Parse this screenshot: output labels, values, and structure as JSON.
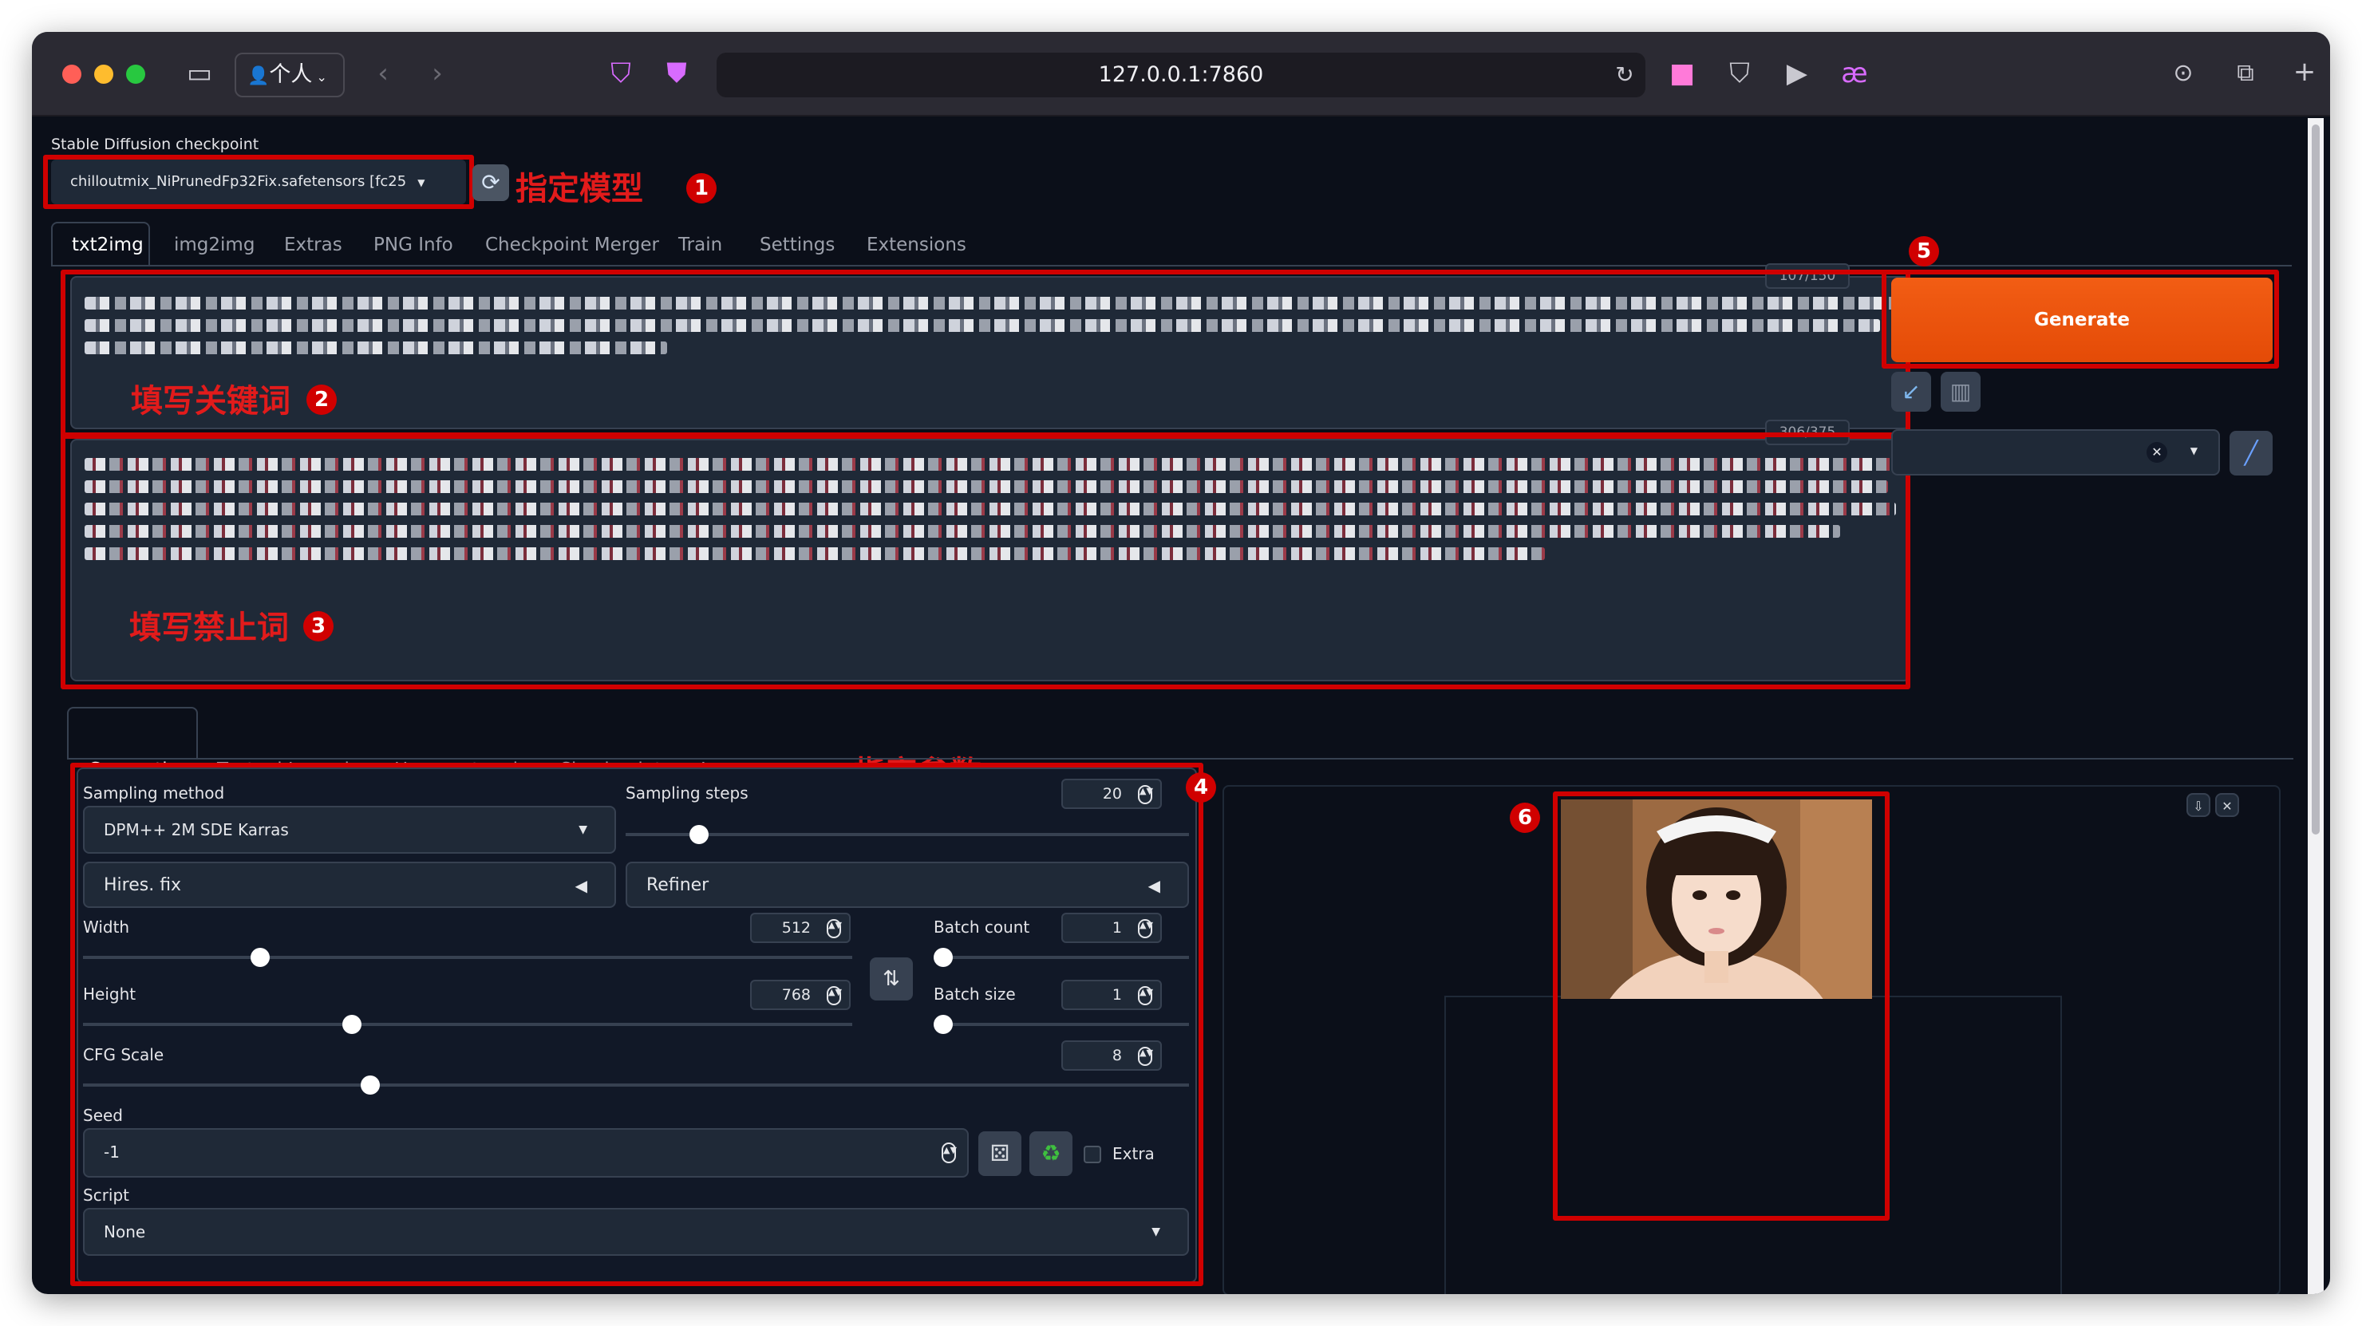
{
  "browser": {
    "profile_label": "个人",
    "url": "127.0.0.1:7860"
  },
  "checkpoint": {
    "label": "Stable Diffusion checkpoint",
    "value": "chilloutmix_NiPrunedFp32Fix.safetensors [fc25"
  },
  "main_tabs": [
    "txt2img",
    "img2img",
    "Extras",
    "PNG Info",
    "Checkpoint Merger",
    "Train",
    "Settings",
    "Extensions"
  ],
  "prompt": {
    "counter": "107/150"
  },
  "negative_prompt": {
    "counter": "306/375"
  },
  "generate_label": "Generate",
  "sub_tabs": [
    "Generation",
    "Textual Inversion",
    "Hypernetworks",
    "Checkpoints",
    "Lora"
  ],
  "params": {
    "sampling_method_label": "Sampling method",
    "sampling_method": "DPM++ 2M SDE Karras",
    "sampling_steps_label": "Sampling steps",
    "sampling_steps": "20",
    "sampling_steps_fraction": 0.13,
    "hires_label": "Hires. fix",
    "refiner_label": "Refiner",
    "width_label": "Width",
    "width": "512",
    "width_fraction": 0.23,
    "height_label": "Height",
    "height": "768",
    "height_fraction": 0.35,
    "batch_count_label": "Batch count",
    "batch_count": "1",
    "batch_size_label": "Batch size",
    "batch_size": "1",
    "cfg_label": "CFG Scale",
    "cfg": "8",
    "cfg_fraction": 0.26,
    "seed_label": "Seed",
    "seed": "-1",
    "extra_label": "Extra",
    "script_label": "Script",
    "script": "None"
  },
  "annotations": {
    "model": "指定模型",
    "keywords": "填写关键词",
    "forbidden": "填写禁止词",
    "params": "指定参数",
    "n1": "1",
    "n2": "2",
    "n3": "3",
    "n4": "4",
    "n5": "5",
    "n6": "6"
  },
  "colors": {
    "accent": "#e9560c",
    "annotation_red": "#d00000",
    "background": "#0b0f19",
    "panel": "#1f2937"
  }
}
